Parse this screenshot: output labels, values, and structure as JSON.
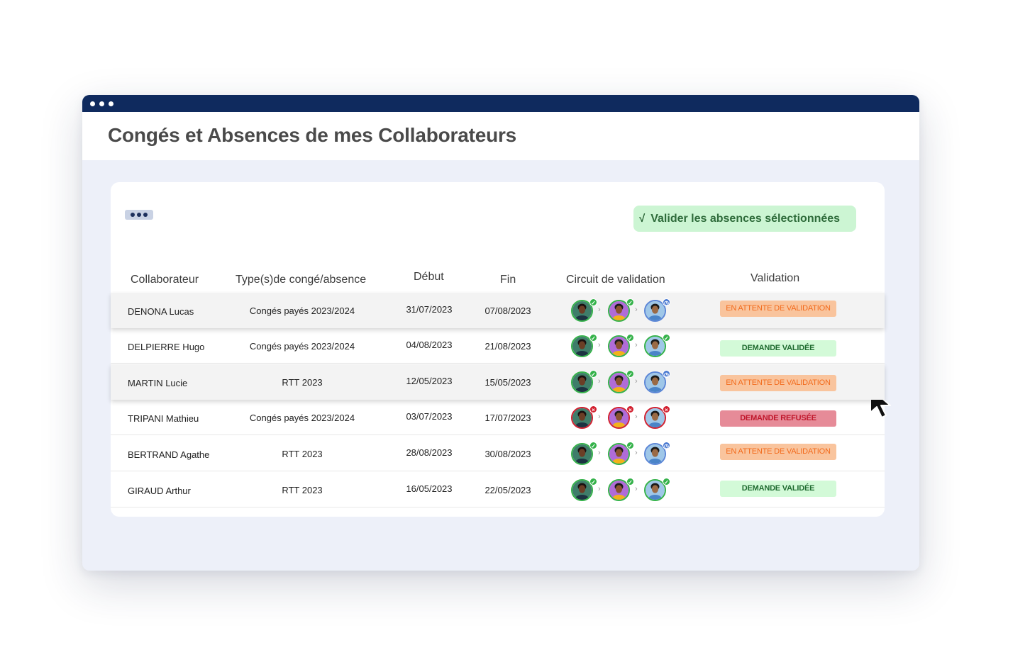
{
  "app": {
    "page_title": "Congés et Absences de mes Collaborateurs",
    "validate_button": "Valider les absences sélectionnées"
  },
  "table": {
    "headers": {
      "collaborateur": "Collaborateur",
      "type": "Type(s)de congé/absence",
      "debut": "Début",
      "fin": "Fin",
      "circuit": "Circuit de validation",
      "validation": "Validation"
    },
    "rows": [
      {
        "name": "DENONA Lucas",
        "type": "Congés payés 2023/2024",
        "start": "31/07/2023",
        "end": "07/08/2023",
        "approvers": [
          "approved",
          "approved",
          "pending"
        ],
        "status": "EN ATTENTE DE VALIDATION",
        "status_kind": "pending"
      },
      {
        "name": "DELPIERRE Hugo",
        "type": "Congés payés 2023/2024",
        "start": "04/08/2023",
        "end": "21/08/2023",
        "approvers": [
          "approved",
          "approved",
          "approved"
        ],
        "status": "DEMANDE VALIDÉE",
        "status_kind": "approved"
      },
      {
        "name": "MARTIN Lucie",
        "type": "RTT 2023",
        "start": "12/05/2023",
        "end": "15/05/2023",
        "approvers": [
          "approved",
          "approved",
          "pending"
        ],
        "status": "EN ATTENTE DE VALIDATION",
        "status_kind": "pending"
      },
      {
        "name": "TRIPANI Mathieu",
        "type": "Congés payés 2023/2024",
        "start": "03/07/2023",
        "end": "17/07/2023",
        "approvers": [
          "refused",
          "refused",
          "refused"
        ],
        "status": "DEMANDE REFUSÉE",
        "status_kind": "refused"
      },
      {
        "name": "BERTRAND Agathe",
        "type": "RTT 2023",
        "start": "28/08/2023",
        "end": "30/08/2023",
        "approvers": [
          "approved",
          "approved",
          "pending"
        ],
        "status": "EN ATTENTE DE VALIDATION",
        "status_kind": "pending"
      },
      {
        "name": "GIRAUD Arthur",
        "type": "RTT 2023",
        "start": "16/05/2023",
        "end": "22/05/2023",
        "approvers": [
          "approved",
          "approved",
          "approved"
        ],
        "status": "DEMANDE VALIDÉE",
        "status_kind": "approved"
      }
    ]
  },
  "colors": {
    "titlebar": "#0f2a5e",
    "approved": "#35b24a",
    "pending": "#4a79d1",
    "refused": "#d21f2e"
  },
  "icons": [
    "more-icon",
    "check-icon",
    "chevron-right-icon",
    "approved-check-icon",
    "pending-clock-icon",
    "refused-cross-icon",
    "cursor-arrow-icon"
  ]
}
